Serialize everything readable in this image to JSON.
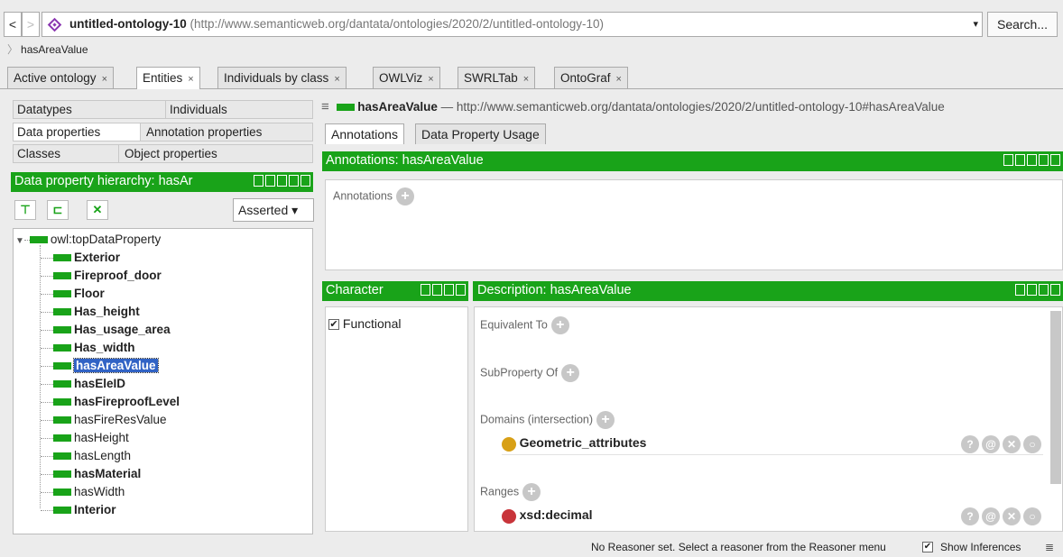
{
  "header": {
    "back": "<",
    "forward": ">",
    "ontology_name": "untitled-ontology-10",
    "ontology_url": "(http://www.semanticweb.org/dantata/ontologies/2020/2/untitled-ontology-10)",
    "dropdown_arrow": "▾",
    "search_label": "Search...",
    "breadcrumb": "hasAreaValue"
  },
  "tabs": [
    {
      "label": "Active ontology"
    },
    {
      "label": "Entities"
    },
    {
      "label": "Individuals by class"
    },
    {
      "label": "OWLViz"
    },
    {
      "label": "SWRLTab"
    },
    {
      "label": "OntoGraf"
    }
  ],
  "tab_close": "×",
  "left": {
    "selector_tabs": [
      "Datatypes",
      "Individuals",
      "Data properties",
      "Annotation properties",
      "Classes",
      "Object properties"
    ],
    "hierarchy_title": "Data property hierarchy: hasAr",
    "asserted": "Asserted ▾",
    "root": "owl:topDataProperty",
    "tree_items": [
      {
        "label": "Exterior",
        "bold": true
      },
      {
        "label": "Fireproof_door",
        "bold": true
      },
      {
        "label": "Floor",
        "bold": true
      },
      {
        "label": "Has_height",
        "bold": true
      },
      {
        "label": "Has_usage_area",
        "bold": true
      },
      {
        "label": "Has_width",
        "bold": true
      },
      {
        "label": "hasAreaValue",
        "bold": true,
        "selected": true
      },
      {
        "label": "hasEleID",
        "bold": true
      },
      {
        "label": "hasFireproofLevel",
        "bold": true
      },
      {
        "label": "hasFireResValue",
        "bold": false
      },
      {
        "label": "hasHeight",
        "bold": false
      },
      {
        "label": "hasLength",
        "bold": false
      },
      {
        "label": "hasMaterial",
        "bold": true
      },
      {
        "label": "hasWidth",
        "bold": false
      },
      {
        "label": "Interior",
        "bold": true
      }
    ]
  },
  "right": {
    "entity_name": "hasAreaValue",
    "entity_iri": "— http://www.semanticweb.org/dantata/ontologies/2020/2/untitled-ontology-10#hasAreaValue",
    "subtabs": [
      "Annotations",
      "Data Property Usage"
    ],
    "annotations_title": "Annotations: hasAreaValue",
    "annotations_label": "Annotations",
    "character_title": "Character",
    "functional_label": "Functional",
    "description_title": "Description: hasAreaValue",
    "equivalent_to": "Equivalent To",
    "subproperty_of": "SubProperty Of",
    "domains": "Domains (intersection)",
    "domain_value": "Geometric_attributes",
    "ranges": "Ranges",
    "range_value": "xsd:decimal"
  },
  "status": {
    "reasoner_text": "No Reasoner set. Select a reasoner from the Reasoner menu",
    "show_inferences": "Show Inferences"
  },
  "colors": {
    "accent_green": "#19a319",
    "selection_blue": "#3163c5",
    "domain_dot": "#d8a016",
    "range_dot": "#c8343a"
  }
}
